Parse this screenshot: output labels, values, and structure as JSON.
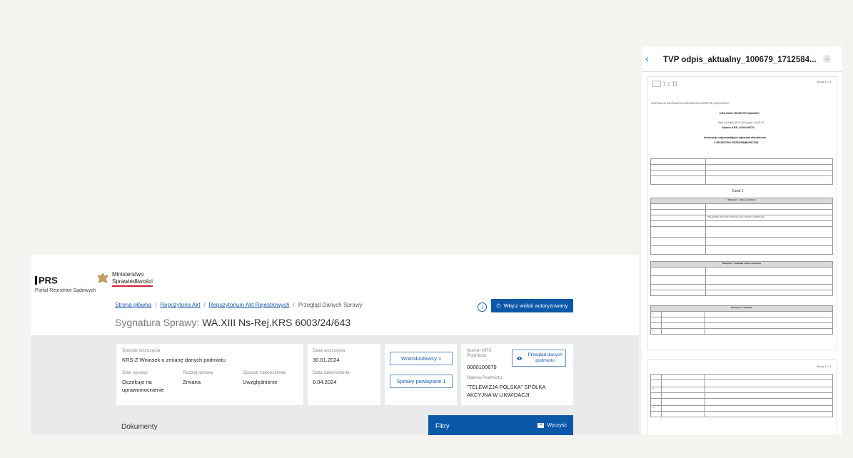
{
  "portal": {
    "prs_title": "PRS",
    "prs_subtitle": "Portal Rejestrów Sądowych",
    "ministry_line1": "Ministerstwo",
    "ministry_line2": "Sprawiedliwości",
    "breadcrumb": [
      "Strona główna",
      "Repozytoria Akt",
      "Repozytorium Akt Rejestrowych",
      "Przegląd Danych Sprawy"
    ],
    "sygnatura_label": "Sygnatura Sprawy:",
    "sygnatura_value": "WA.XIII Ns-Rej.KRS 6003/24/643",
    "auth_button": "Włącz widok autoryzowany",
    "case": {
      "sposob_label": "Sposób wszczęcia",
      "sposob_value": "KRS-Z Wniosek o zmianę danych podmiotu",
      "stan_label": "Stan sprawy",
      "stan_value": "Oczekuje na uprawomocnienie",
      "rodzaj_label": "Rodzaj sprawy",
      "rodzaj_value": "Zmiana",
      "zakonczenie_label": "Sposób zakończenia",
      "zakonczenie_value": "Uwzględnienie"
    },
    "dates": {
      "wszczecia_label": "Data wszczęcia",
      "wszczecia_value": "30.01.2024",
      "zakonczenia_label": "Data zakończenia",
      "zakonczenia_value": "8.04.2024"
    },
    "wnioskodawcy_button": "Wnioskodawcy 1",
    "powiazane_button": "Sprawy powiązane 1",
    "krs_label": "Numer KRS Podmiotu",
    "krs_value": "0000100679",
    "nazwa_label": "Nazwa Podmiotu",
    "nazwa_value": "\"TELEWIZJA POLSKA\" SPÓŁKA AKCYJNA W LIKWIDACJI",
    "przeglad_button": "Przegląd danych podmiotu",
    "dokumenty": "Dokumenty",
    "filtry": "Filtry",
    "wyczysc": "Wyczyść"
  },
  "viewer": {
    "back_icon": "chevron-left-icon",
    "title": "TVP odpis_aktualny_100679_1712584...",
    "page_counter": "1 z 11",
    "page1": {
      "strona": "Strona 1 z 11",
      "header_line": "CENTRALNA INFORMACJA KRAJOWEGO REJESTRU SĄDOWEGO",
      "krs_title": "KRAJOWY REJESTR SĄDOWY",
      "stan": "Stan na dzień 08.04.2024 godz. 16:00:39",
      "numer": "Numer KRS: 0000100679",
      "info1": "Informacja odpowiadająca odpisowi aktualnemu",
      "info2": "Z REJESTRU PRZEDSIĘBIORCÓW",
      "dzial": "Dział 1",
      "rubryka1": "Rubryka 1 - Dane podmiotu",
      "rubryka2": "Rubryka 2 - Siedziba i adres podmiotu",
      "rubryka3": "Rubryka 3 - Oddziały",
      "nazwa": "\"TELEWIZJA POLSKA\" SPÓŁKA AKCYJNA W LIKWIDACJI"
    },
    "page2": {
      "strona": "Strona 2 z 11"
    }
  }
}
